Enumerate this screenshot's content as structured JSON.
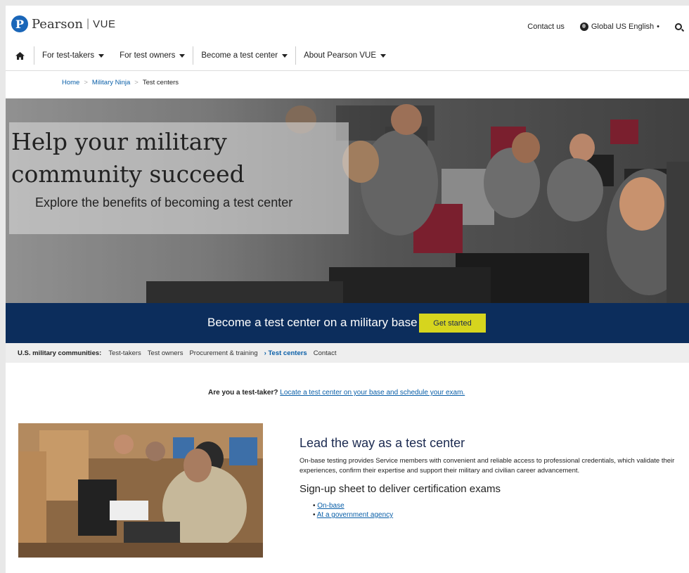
{
  "header": {
    "logo_letter": "P",
    "logo_name": "Pearson",
    "logo_separator": "|",
    "logo_product": "VUE",
    "contact_label": "Contact us",
    "language_label": "Global US English",
    "language_caret": "•"
  },
  "nav": {
    "items": [
      {
        "label": "For test-takers"
      },
      {
        "label": "For test owners"
      },
      {
        "label": "Become a test center"
      },
      {
        "label": "About Pearson VUE"
      }
    ]
  },
  "breadcrumb": {
    "items": [
      "Home",
      "Military Ninja",
      "Test centers"
    ],
    "separator": ">"
  },
  "hero": {
    "title": "Help your military community succeed",
    "subtitle": "Explore the benefits of becoming a test center"
  },
  "cta": {
    "text": "Become a test center on a military base",
    "button_label": "Get started",
    "button_color": "#d6d51e",
    "band_color": "#0c2d5c"
  },
  "subnav": {
    "label": "U.S. military communities:",
    "items": [
      "Test-takers",
      "Test owners",
      "Procurement & training",
      "› Test centers",
      "Contact"
    ],
    "active_index": 3
  },
  "locate": {
    "question": "Are you a test-taker?",
    "link": "Locate a test center on your base and schedule your exam."
  },
  "content": {
    "heading": "Lead the way as a test center",
    "body": "On-base testing provides Service members with convenient and reliable access to professional credentials, which validate their experiences, confirm their expertise and support their military and civilian career advancement.",
    "subheading": "Sign-up sheet to deliver certification exams",
    "links": [
      "On-base",
      "At a government agency"
    ]
  }
}
